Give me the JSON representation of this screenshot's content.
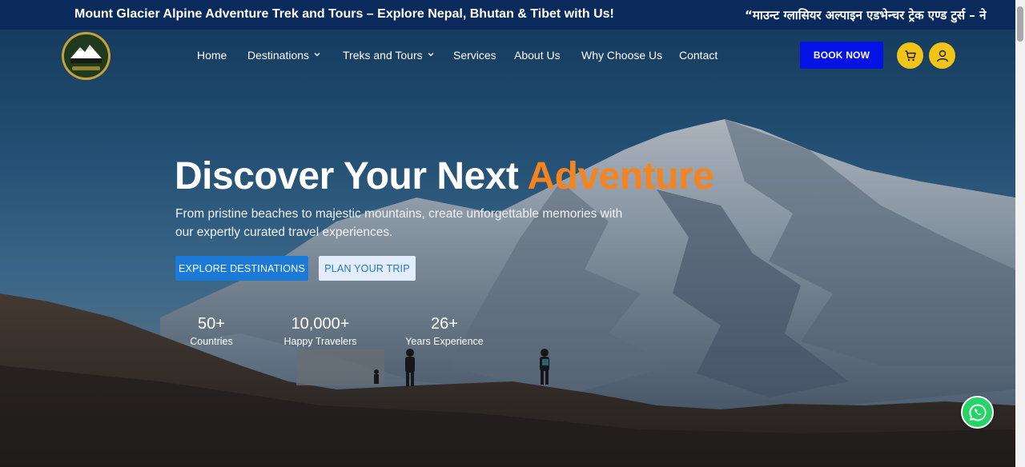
{
  "ticker": {
    "english": "Mount Glacier Alpine Adventure Trek and Tours – Explore Nepal, Bhutan & Tibet with Us!",
    "nepali": "“माउन्ट ग्लासियर अल्पाइन एडभेन्चर ट्रेक एण्ड टुर्स – ने"
  },
  "logo": {
    "text": "MOUNT GLACIER ALPINE"
  },
  "nav": {
    "items": [
      {
        "label": "Home",
        "dropdown": false
      },
      {
        "label": "Destinations",
        "dropdown": true
      },
      {
        "label": "Treks and Tours",
        "dropdown": true
      },
      {
        "label": "Services",
        "dropdown": false
      },
      {
        "label": "About Us",
        "dropdown": false
      },
      {
        "label": "Why Choose Us",
        "dropdown": false
      },
      {
        "label": "Contact",
        "dropdown": false
      }
    ],
    "book_label": "BOOK NOW",
    "cart_icon": "cart-icon",
    "user_icon": "user-icon"
  },
  "hero": {
    "headline_main": "Discover Your Next ",
    "headline_accent": "Adventure",
    "subtext": "From pristine beaches to majestic mountains, create unforgettable memories with our expertly curated travel experiences.",
    "primary_label": "EXPLORE DESTINATIONS",
    "secondary_label": "PLAN YOUR TRIP"
  },
  "stats": [
    {
      "value": "50+",
      "label": "Countries"
    },
    {
      "value": "10,000+",
      "label": "Happy Travelers"
    },
    {
      "value": "26+",
      "label": "Years Experience"
    }
  ],
  "colors": {
    "ticker_bg": "#0a2a5c",
    "book_bg": "#0412e6",
    "accent": "#f5841f",
    "icon_btn": "#f0c419",
    "primary_btn": "#1b7ad8",
    "whatsapp": "#25d366"
  }
}
